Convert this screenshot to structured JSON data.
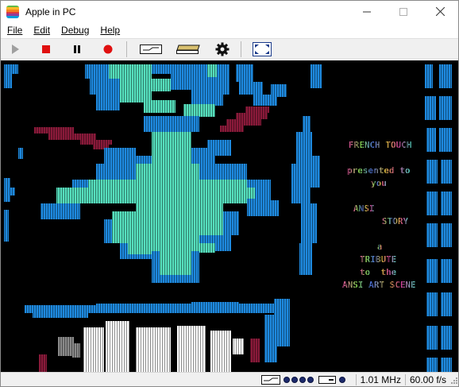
{
  "window": {
    "title": "Apple in PC"
  },
  "menu": {
    "items": [
      "File",
      "Edit",
      "Debug",
      "Help"
    ]
  },
  "toolbar": {
    "buttons": [
      "play-icon",
      "stop-icon",
      "pause-icon",
      "record-icon",
      "disk-drive-icon",
      "keyboard-icon",
      "gear-icon",
      "fullscreen-icon"
    ]
  },
  "screen": {
    "text_lines": [
      "FRENCH TOUCH",
      "presented to",
      "you",
      "ANSI",
      "STORY",
      "a",
      "TRIBUTE",
      "to  the",
      "ANSI ART SCENE"
    ]
  },
  "status": {
    "speed": "1.01 MHz",
    "fps": "60.00 f/s"
  },
  "colors": {
    "screen_bg": "#000000",
    "blue": "#1e8ae0",
    "aqua": "#56e0be",
    "maroon": "#8a1a3a",
    "white": "#ffffff",
    "toolbar_bg": "#f0f0f0"
  }
}
